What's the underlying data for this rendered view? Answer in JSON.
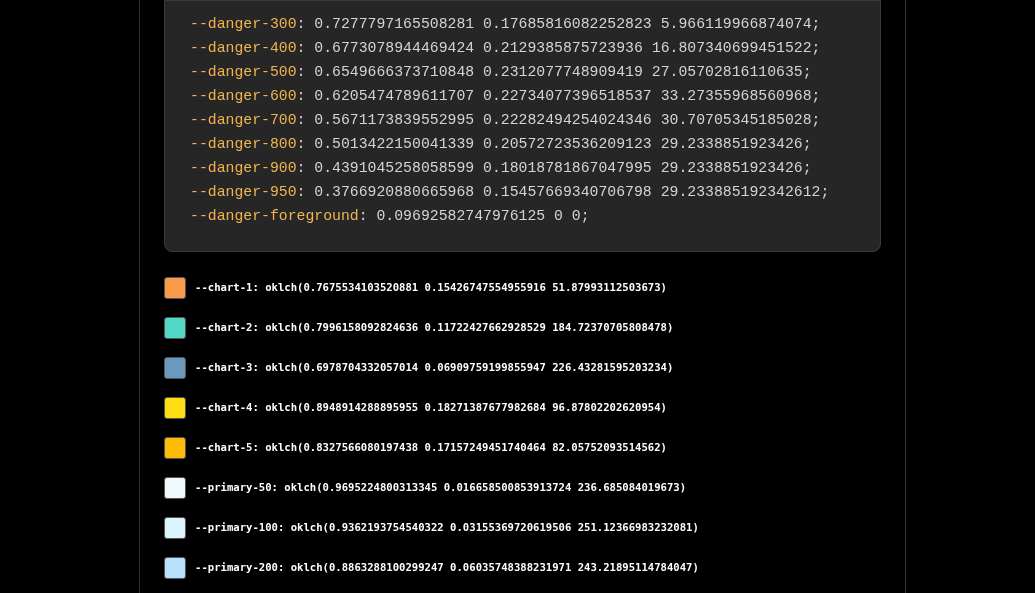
{
  "code_block": {
    "lines": [
      {
        "property": "--danger-300",
        "value": ": 0.7277797165508281 0.17685816082252823 5.966119966874074;"
      },
      {
        "property": "--danger-400",
        "value": ": 0.6773078944469424 0.2129385875723936 16.807340699451522;"
      },
      {
        "property": "--danger-500",
        "value": ": 0.6549666373710848 0.2312077748909419 27.05702816110635;"
      },
      {
        "property": "--danger-600",
        "value": ": 0.6205474789611707 0.22734077396518537 33.27355968560968;"
      },
      {
        "property": "--danger-700",
        "value": ": 0.5671173839552995 0.22282494254024346 30.70705345185028;"
      },
      {
        "property": "--danger-800",
        "value": ": 0.5013422150041339 0.20572723536209123 29.2338851923426;"
      },
      {
        "property": "--danger-900",
        "value": ": 0.4391045258058599 0.18018781867047995 29.2338851923426;"
      },
      {
        "property": "--danger-950",
        "value": ": 0.3766920880665968 0.15457669340706798 29.233885192342612;"
      },
      {
        "property": "--danger-foreground",
        "value": ": 0.09692582747976125 0 0;"
      }
    ]
  },
  "swatches": [
    {
      "label": "--chart-1: oklch(0.7675534103520881 0.15426747554955916 51.87993112503673)",
      "color": "#f99b4a"
    },
    {
      "label": "--chart-2: oklch(0.7996158092824636 0.11722427662928529 184.72370705808478)",
      "color": "#52d8c7"
    },
    {
      "label": "--chart-3: oklch(0.6978704332057014 0.06909759199855947 226.43281595203234)",
      "color": "#6c97be"
    },
    {
      "label": "--chart-4: oklch(0.8948914288895955 0.18271387677982684 96.87802202620954)",
      "color": "#ffdd12"
    },
    {
      "label": "--chart-5: oklch(0.8327566080197438 0.17157249451740464 82.05752093514562)",
      "color": "#fdbb06"
    },
    {
      "label": "--primary-50: oklch(0.9695224800313345 0.016658500853913724 236.685084019673)",
      "color": "#eef8fd"
    },
    {
      "label": "--primary-100: oklch(0.9362193754540322 0.03155369720619506 251.12366983232081)",
      "color": "#dcf4fd"
    },
    {
      "label": "--primary-200: oklch(0.8863288100299247 0.06035748388231971 243.21895114784047)",
      "color": "#b8e2fc"
    }
  ]
}
